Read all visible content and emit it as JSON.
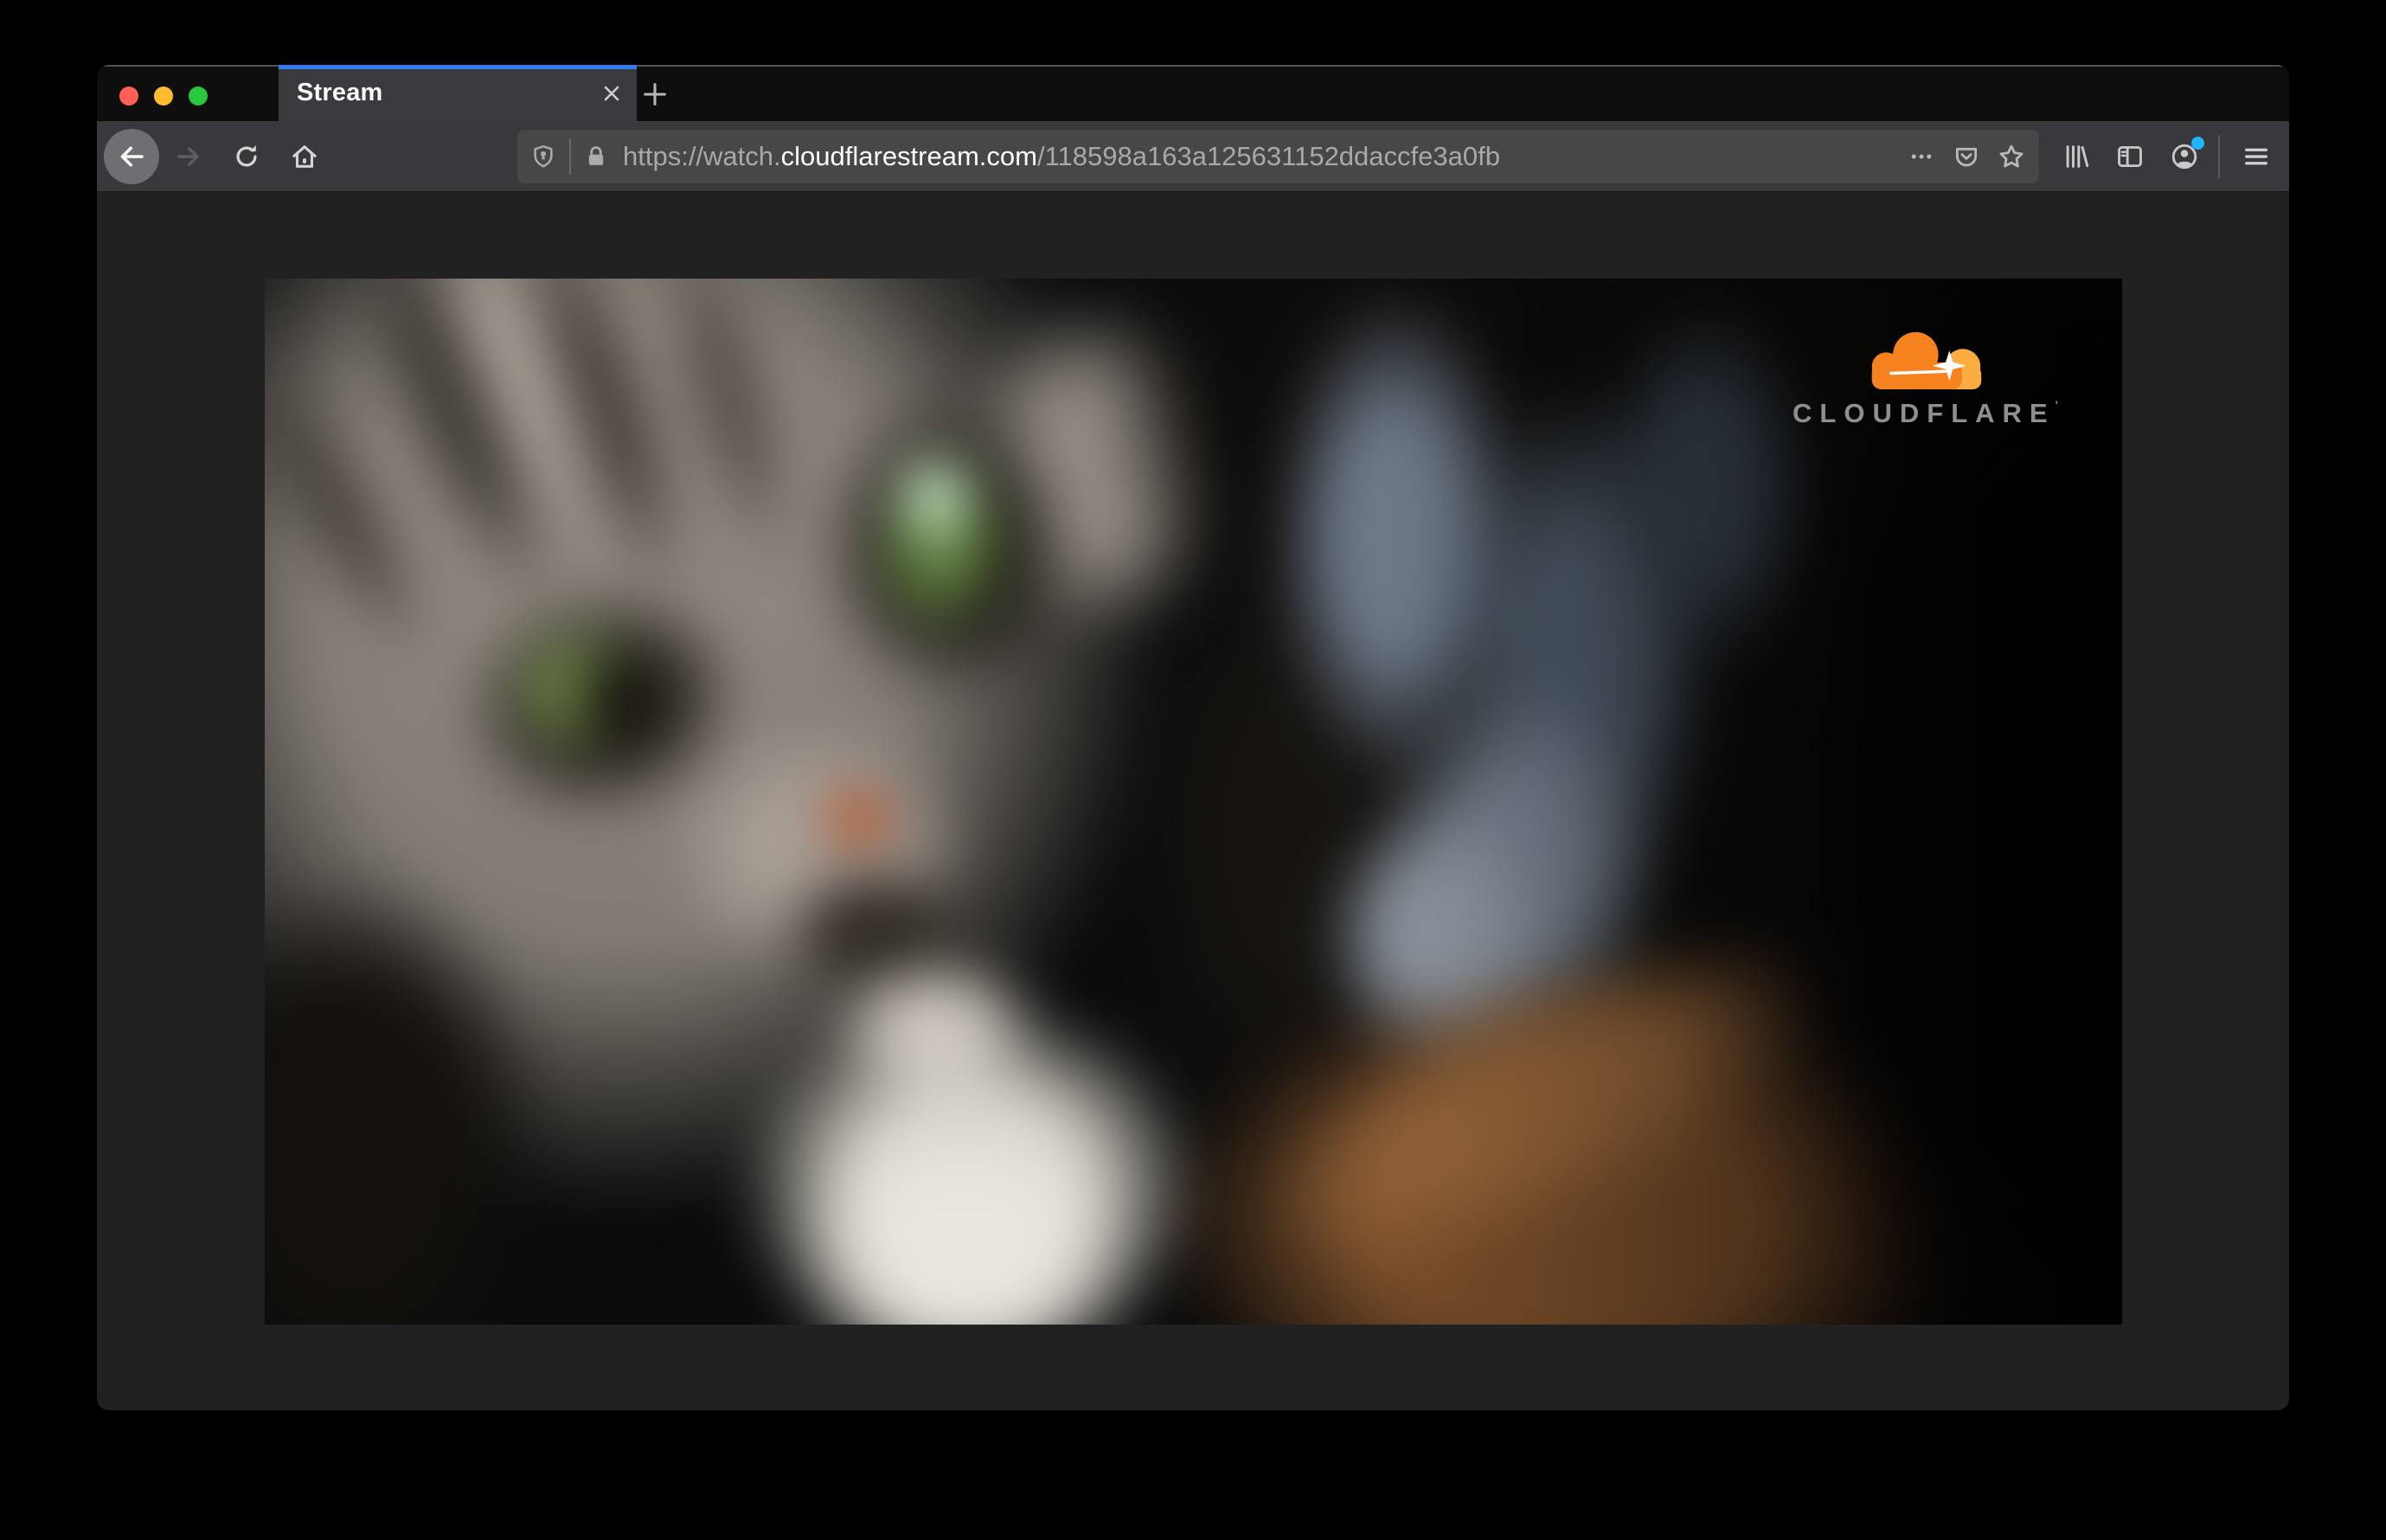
{
  "window": {
    "tab": {
      "title": "Stream"
    },
    "toolbar": {
      "url": {
        "scheme_host": "https://watch.",
        "domain": "cloudflarestream.com",
        "path": "/118598a163a125631152ddaccfe3a0fb"
      }
    }
  },
  "video": {
    "logo": {
      "text": "CLOUDFLARE",
      "mark": "'"
    }
  },
  "icons": [
    "traffic-close-icon",
    "traffic-minimize-icon",
    "traffic-zoom-icon",
    "close-icon",
    "new-tab-icon",
    "back-icon",
    "forward-icon",
    "reload-icon",
    "home-icon",
    "shield-icon",
    "lock-icon",
    "page-actions-icon",
    "pocket-icon",
    "bookmark-star-icon",
    "library-icon",
    "sidebar-icon",
    "account-icon",
    "menu-icon",
    "cloudflare-cloud-icon"
  ],
  "colors": {
    "tab_accent_blue": "#2f7cf1",
    "toolbar_bg": "#38383d",
    "urlbar_bg": "#47474a",
    "content_bg": "#212121",
    "notification_dot": "#1db8ff",
    "traffic_red": "#ff5f57",
    "traffic_yellow": "#febc2e",
    "traffic_green": "#28c840",
    "cloudflare_orange": "#f6821f",
    "cloudflare_light_orange": "#fbad41",
    "logo_text_gray": "#8f8f8f"
  }
}
